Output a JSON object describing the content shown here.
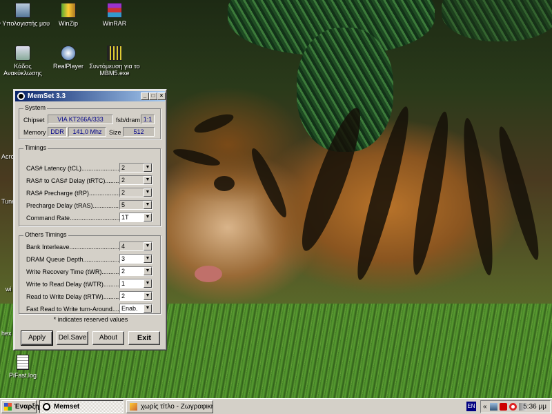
{
  "desktop": {
    "icons": [
      {
        "label": "Ο Υπολογιστής μου",
        "icon": "my-computer-icon"
      },
      {
        "label": "WinZip",
        "icon": "winzip-icon"
      },
      {
        "label": "WinRAR",
        "icon": "winrar-icon"
      },
      {
        "label": "Κάδος Ανακύκλωσης",
        "icon": "recycle-bin-icon"
      },
      {
        "label": "RealPlayer",
        "icon": "realplayer-icon"
      },
      {
        "label": "Συντόμευση για το MBM5.exe",
        "icon": "mbm5-shortcut-icon"
      },
      {
        "label": "PiFast.log",
        "icon": "text-file-icon"
      }
    ],
    "partial_labels": [
      "Acro",
      "Tune",
      "wi",
      "hex"
    ]
  },
  "window": {
    "title": "MemSet 3.3",
    "system": {
      "group_label": "System",
      "chipset_label": "Chipset",
      "chipset_value": "VIA KT266A/333",
      "fsb_label": "fsb/dram",
      "fsb_value": "1:1",
      "memory_label": "Memory",
      "memory_type": "DDR",
      "memory_speed": "141,0 Mhz",
      "size_label": "Size",
      "size_value": "512"
    },
    "timings": {
      "group_label": "Timings",
      "rows": [
        {
          "label": "CAS# Latency (tCL)........................",
          "value": "2"
        },
        {
          "label": "RAS# to CAS# Delay (tRTC)..........",
          "value": "2"
        },
        {
          "label": "RAS# Precharge (tRP)..................",
          "value": "2"
        },
        {
          "label": "Precharge Delay  (tRAS)...............",
          "value": "5"
        },
        {
          "label": "Command Rate..............................",
          "value": "1T"
        }
      ]
    },
    "other_timings": {
      "group_label": "Others Timings",
      "rows": [
        {
          "label": "Bank Interleave.............................",
          "value": "4"
        },
        {
          "label": "DRAM Queue Depth........................",
          "value": "3"
        },
        {
          "label": "Write Recovery Time (tWR)...........",
          "value": "2"
        },
        {
          "label": "Write to Read Delay (tWTR)...........",
          "value": "1"
        },
        {
          "label": "Read to Write Delay (tRTW)...........",
          "value": "2"
        },
        {
          "label": "Fast Read to Write turn-Around.........",
          "value": "Enab."
        }
      ]
    },
    "note": "* indicates reserved values",
    "buttons": {
      "apply": "Apply",
      "delsave": "Del.Save",
      "about": "About",
      "exit": "Exit"
    }
  },
  "taskbar": {
    "start_label": "Έναρξη",
    "tasks": [
      {
        "label": "Memset",
        "active": true
      },
      {
        "label": "χωρίς τίτλο - Ζωγραφική",
        "active": false
      }
    ],
    "language": "EN",
    "clock": "5:36 μμ"
  }
}
